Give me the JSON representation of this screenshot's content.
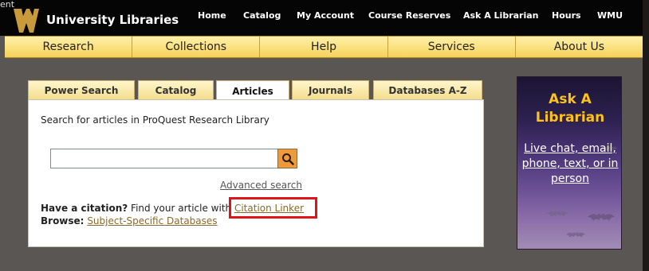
{
  "header": {
    "fragment": "ent",
    "brand": "University Libraries",
    "links": [
      "Home",
      "Catalog",
      "My Account",
      "Course Reserves",
      "Ask A Librarian",
      "Hours",
      "WMU"
    ]
  },
  "mainnav": [
    "Research",
    "Collections",
    "Help",
    "Services",
    "About Us"
  ],
  "tabs": [
    "Power Search",
    "Catalog",
    "Articles",
    "Journals",
    "Databases A-Z"
  ],
  "active_tab": "Articles",
  "search": {
    "lead": "Search for articles in ProQuest Research Library",
    "input_value": "",
    "advanced": "Advanced search",
    "citation_label": "Have a citation?",
    "citation_text": " Find your article with ",
    "citation_link": "Citation Linker",
    "browse_label": "Browse:",
    "browse_link": "Subject-Specific Databases"
  },
  "ask": {
    "title": "Ask A Librarian",
    "text": "Live chat, email, phone, text, or in person"
  },
  "colors": {
    "nav_gold": "#f6d25a",
    "search_button": "#ef9a3a",
    "highlight": "#e0121a",
    "ask_title": "#ffc21a"
  },
  "icons": {
    "search_button": "magnifier-icon",
    "logo": "wmu-w-logo"
  }
}
